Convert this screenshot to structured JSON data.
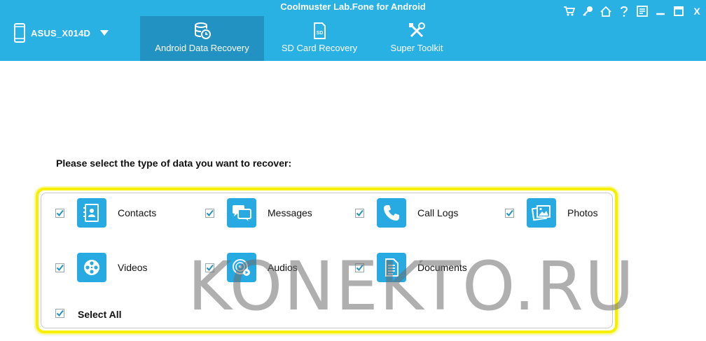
{
  "app": {
    "title": "Coolmuster Lab.Fone for Android"
  },
  "device": {
    "name": "ASUS_X014D"
  },
  "tabs": [
    {
      "label": "Android Data Recovery",
      "icon": "database-recovery-icon",
      "active": true
    },
    {
      "label": "SD Card Recovery",
      "icon": "sd-card-icon",
      "active": false
    },
    {
      "label": "Super Toolkit",
      "icon": "tools-icon",
      "active": false
    }
  ],
  "window_controls": {
    "close_label": "X"
  },
  "main": {
    "prompt": "Please select the type of data you want to recover:",
    "items": [
      {
        "label": "Contacts",
        "icon": "contacts-icon",
        "checked": true
      },
      {
        "label": "Messages",
        "icon": "messages-icon",
        "checked": true
      },
      {
        "label": "Call Logs",
        "icon": "phone-icon",
        "checked": true
      },
      {
        "label": "Photos",
        "icon": "photos-icon",
        "checked": true
      },
      {
        "label": "Videos",
        "icon": "film-reel-icon",
        "checked": true
      },
      {
        "label": "Audios",
        "icon": "audio-disc-icon",
        "checked": true
      },
      {
        "label": "Documents",
        "icon": "document-icon",
        "checked": true
      }
    ],
    "select_all": {
      "label": "Select All",
      "checked": true
    }
  },
  "watermark": {
    "text": "KONEKTO.RU"
  },
  "colors": {
    "header": "#2ab1e4",
    "active_tab": "#2292c2",
    "icon_tile": "#27a9e1",
    "highlight": "#f6f000",
    "check": "#2292c2"
  }
}
